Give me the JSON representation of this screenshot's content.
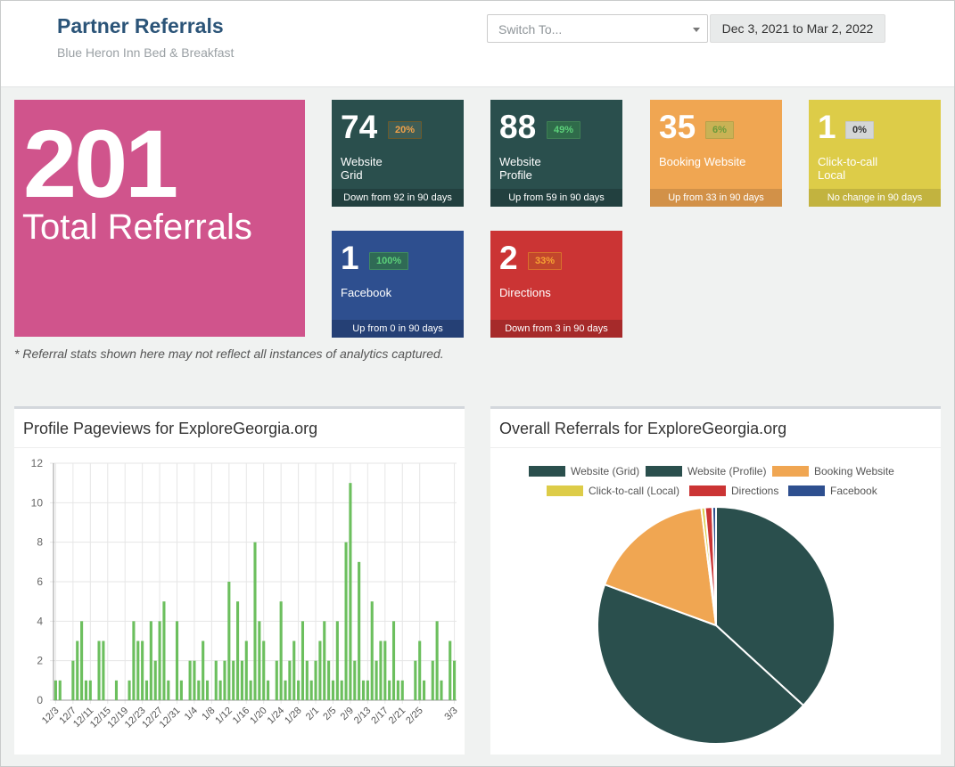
{
  "header": {
    "title": "Partner Referrals",
    "subtitle": "Blue Heron Inn Bed & Breakfast",
    "switch_placeholder": "Switch To...",
    "date_range": "Dec 3, 2021 to Mar 2, 2022"
  },
  "total": {
    "value": "201",
    "label": "Total Referrals",
    "color": "#d0548c"
  },
  "tiles": [
    {
      "value": "74",
      "badge": "20%",
      "label_line1": "Website",
      "label_line2": "Grid",
      "footer": "Down from 92 in 90 days",
      "color": "#2a4f4d"
    },
    {
      "value": "88",
      "badge": "49%",
      "label_line1": "Website",
      "label_line2": "Profile",
      "footer": "Up from 59 in 90 days",
      "color": "#2a4f4d"
    },
    {
      "value": "35",
      "badge": "6%",
      "label_line1": "Booking Website",
      "label_line2": "",
      "footer": "Up from 33 in 90 days",
      "color": "#f0a652"
    },
    {
      "value": "1",
      "badge": "0%",
      "label_line1": "Click-to-call",
      "label_line2": "Local",
      "footer": "No change in 90 days",
      "color": "#ddcc48"
    },
    {
      "value": "1",
      "badge": "100%",
      "label_line1": "Facebook",
      "label_line2": "",
      "footer": "Up from 0 in 90 days",
      "color": "#2e4f8f"
    },
    {
      "value": "2",
      "badge": "33%",
      "label_line1": "Directions",
      "label_line2": "",
      "footer": "Down from 3 in 90 days",
      "color": "#cb3434"
    }
  ],
  "note": "* Referral stats shown here may not reflect all instances of analytics captured.",
  "panels": {
    "pageviews_title": "Profile Pageviews for ExploreGeorgia.org",
    "referrals_title": "Overall Referrals for ExploreGeorgia.org"
  },
  "chart_data": [
    {
      "type": "bar",
      "title": "Profile Pageviews for ExploreGeorgia.org",
      "xlabel": "",
      "ylabel": "",
      "ylim": [
        0,
        12
      ],
      "yticks": [
        0,
        2,
        4,
        6,
        8,
        10,
        12
      ],
      "tick_labels": [
        "12/3",
        "12/7",
        "12/11",
        "12/15",
        "12/19",
        "12/23",
        "12/27",
        "12/31",
        "1/4",
        "1/8",
        "1/12",
        "1/16",
        "1/20",
        "1/24",
        "1/28",
        "2/1",
        "2/5",
        "2/9",
        "2/13",
        "2/17",
        "2/21",
        "2/25",
        "3/3"
      ],
      "grid": true,
      "color": "#6cbf5e",
      "values": [
        1,
        1,
        0,
        0,
        2,
        3,
        4,
        1,
        1,
        0,
        3,
        3,
        0,
        0,
        1,
        0,
        0,
        1,
        4,
        3,
        3,
        1,
        4,
        2,
        4,
        5,
        1,
        0,
        4,
        1,
        0,
        2,
        2,
        1,
        3,
        1,
        0,
        2,
        1,
        2,
        6,
        2,
        5,
        2,
        3,
        1,
        8,
        4,
        3,
        1,
        0,
        2,
        5,
        1,
        2,
        3,
        1,
        4,
        2,
        1,
        2,
        3,
        4,
        2,
        1,
        4,
        1,
        8,
        11,
        2,
        7,
        1,
        1,
        5,
        2,
        3,
        3,
        1,
        4,
        1,
        1,
        0,
        0,
        2,
        3,
        1,
        0,
        2,
        4,
        1,
        0,
        3,
        2
      ]
    },
    {
      "type": "pie",
      "title": "Overall Referrals for ExploreGeorgia.org",
      "legend_position": "top",
      "series": [
        {
          "name": "Website (Grid)",
          "value": 74,
          "color": "#2a4f4d"
        },
        {
          "name": "Website (Profile)",
          "value": 88,
          "color": "#2a4f4d"
        },
        {
          "name": "Booking Website",
          "value": 35,
          "color": "#f0a652"
        },
        {
          "name": "Click-to-call (Local)",
          "value": 1,
          "color": "#ddcc48"
        },
        {
          "name": "Directions",
          "value": 2,
          "color": "#cb3434"
        },
        {
          "name": "Facebook",
          "value": 1,
          "color": "#2e4f8f"
        }
      ]
    }
  ]
}
